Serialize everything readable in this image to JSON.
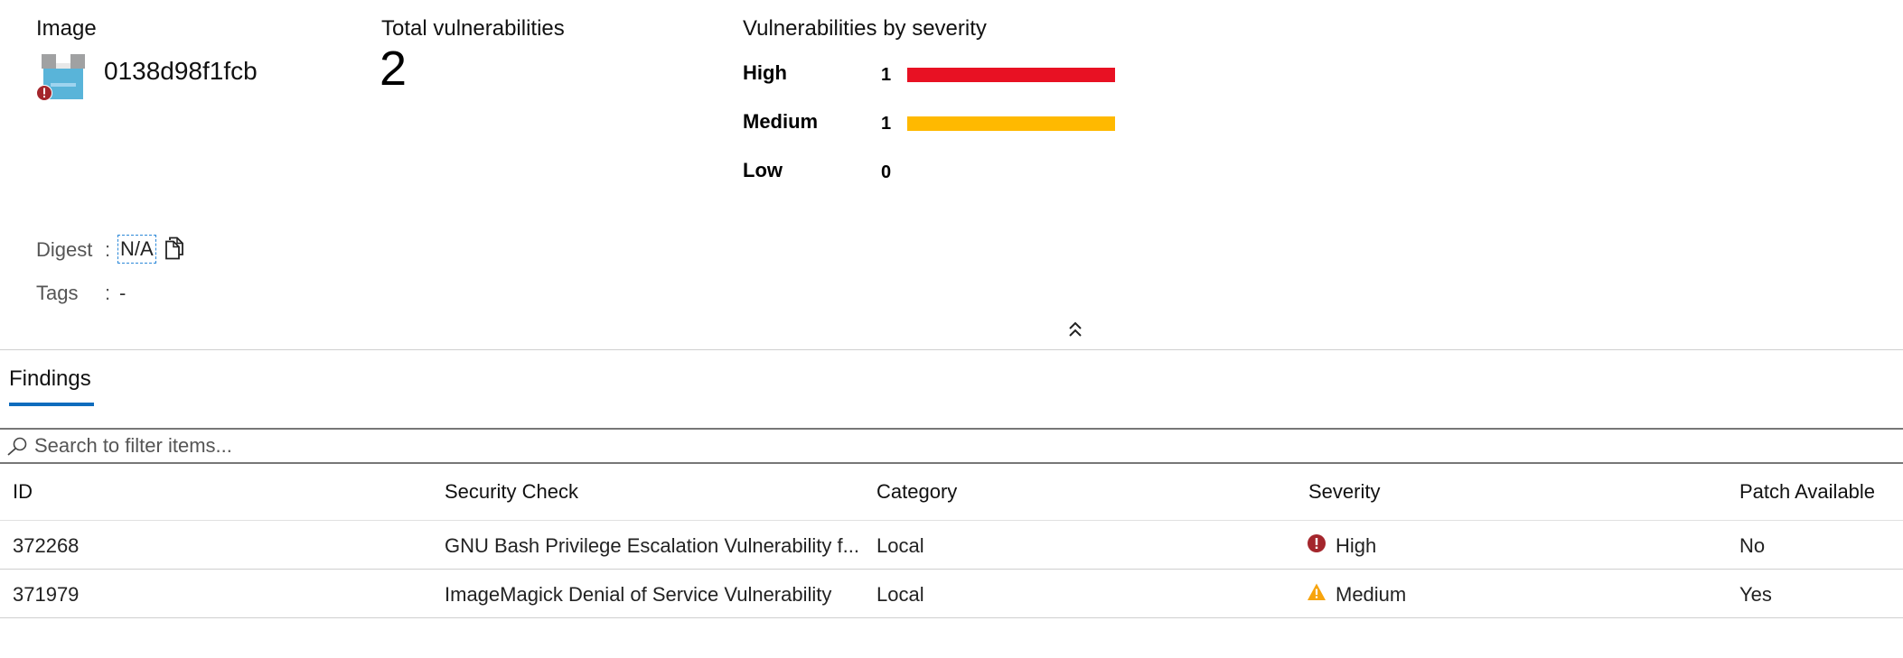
{
  "summary": {
    "image_label": "Image",
    "image_name": "0138d98f1fcb",
    "image_icon": "container-image-icon",
    "image_badge_icon": "error-badge-icon",
    "total_label": "Total vulnerabilities",
    "total_value": "2",
    "severity_title": "Vulnerabilities by severity",
    "severity": [
      {
        "name": "High",
        "count": "1",
        "share": 1.0,
        "color": "#e81123"
      },
      {
        "name": "Medium",
        "count": "1",
        "share": 1.0,
        "color": "#ffb900"
      },
      {
        "name": "Low",
        "count": "0",
        "share": 0.0,
        "color": "#cccccc"
      }
    ]
  },
  "details": {
    "digest_label": "Digest",
    "digest_sep": ":",
    "digest_value": "N/A",
    "tags_label": "Tags",
    "tags_sep": ":",
    "tags_value": "-"
  },
  "tabs": [
    {
      "label": "Findings",
      "active": true
    }
  ],
  "search": {
    "placeholder": "Search to filter items..."
  },
  "table": {
    "columns": [
      "ID",
      "Security Check",
      "Category",
      "Severity",
      "Patch Available"
    ],
    "rows": [
      {
        "id": "372268",
        "check": "GNU Bash Privilege Escalation Vulnerability f...",
        "category": "Local",
        "severity": "High",
        "severity_icon": "error-icon",
        "patch": "No"
      },
      {
        "id": "371979",
        "check": "ImageMagick Denial of Service Vulnerability",
        "category": "Local",
        "severity": "Medium",
        "severity_icon": "warning-icon",
        "patch": "Yes"
      }
    ]
  },
  "colors": {
    "accent": "#0f6cbd",
    "high": "#e81123",
    "medium": "#ffb900",
    "error_icon": "#a4262c",
    "warning_icon": "#f7a40d",
    "image_icon": "#59b4d9"
  }
}
